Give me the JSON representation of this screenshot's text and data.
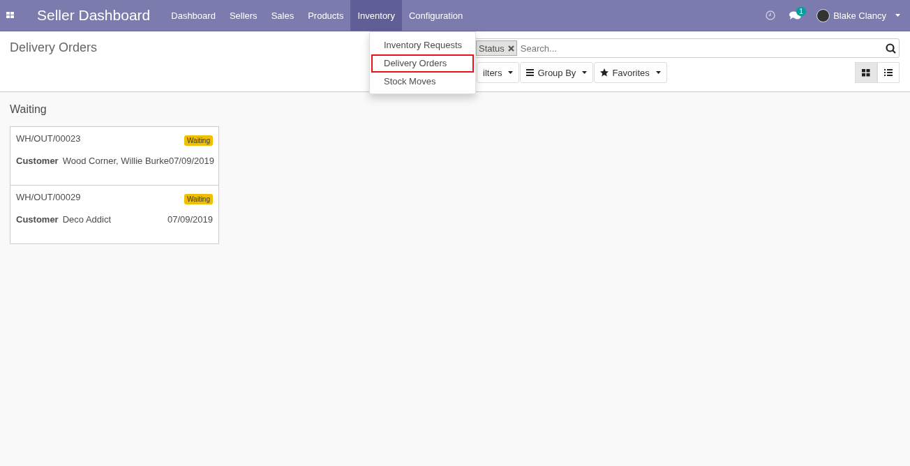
{
  "navbar": {
    "app_title": "Seller Dashboard",
    "menu": [
      {
        "label": "Dashboard",
        "selected": false
      },
      {
        "label": "Sellers",
        "selected": false
      },
      {
        "label": "Sales",
        "selected": false
      },
      {
        "label": "Products",
        "selected": false
      },
      {
        "label": "Inventory",
        "selected": true
      },
      {
        "label": "Configuration",
        "selected": false
      }
    ],
    "messages_count": "1",
    "user": "Blake Clancy"
  },
  "dropdown": {
    "items": [
      {
        "label": "Inventory Requests",
        "selected": false
      },
      {
        "label": "Delivery Orders",
        "selected": true
      },
      {
        "label": "Stock Moves",
        "selected": false
      }
    ]
  },
  "control_panel": {
    "title": "Delivery Orders",
    "search": {
      "facet": "Status",
      "placeholder": "Search..."
    },
    "buttons": [
      {
        "kind": "filters",
        "label": "ilters"
      },
      {
        "kind": "groupby",
        "label": "Group By"
      },
      {
        "kind": "favorites",
        "label": "Favorites"
      }
    ],
    "views": [
      {
        "kind": "kanban",
        "selected": true
      },
      {
        "kind": "list",
        "selected": false
      }
    ]
  },
  "kanban": {
    "group": "Waiting",
    "cards": [
      {
        "reference": "WH/OUT/00023",
        "status": "Waiting",
        "customer_label": "Customer",
        "customer": "Wood Corner, Willie Burke",
        "date": "07/09/2019"
      },
      {
        "reference": "WH/OUT/00029",
        "status": "Waiting",
        "customer_label": "Customer",
        "customer": "Deco Addict",
        "date": "07/09/2019"
      }
    ]
  }
}
